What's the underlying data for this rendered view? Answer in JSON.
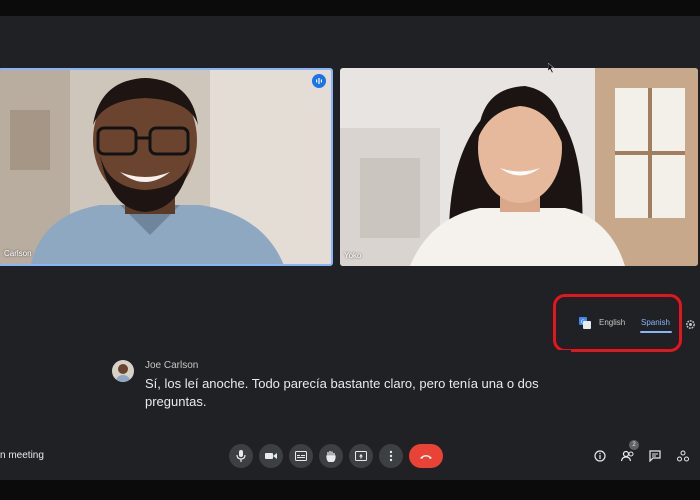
{
  "participants": [
    {
      "name": "Joe Carlson",
      "name_tag": "Carlson"
    },
    {
      "name": "Yoko",
      "name_tag": "Yoko"
    }
  ],
  "captions": {
    "languages": [
      "English",
      "Spanish"
    ],
    "selected_language": "Spanish",
    "speaker": "Joe Carlson",
    "text": "Sí, los leí anoche. Todo parecía bastante claro, pero tenía una o dos preguntas."
  },
  "bottom_bar": {
    "meeting_label": "n meeting",
    "people_count": "2"
  },
  "colors": {
    "background": "#202124",
    "accent": "#8ab4f8",
    "end_call": "#ea4335",
    "highlight": "#e8141b"
  },
  "icons": {
    "speaking": "speaking-icon",
    "translate": "translate-icon",
    "settings": "gear-icon",
    "mic": "mic-icon",
    "camera": "camera-icon",
    "captions": "captions-icon",
    "hand": "raise-hand-icon",
    "present": "present-icon",
    "more": "more-vert-icon",
    "end_call": "end-call-icon",
    "info": "info-icon",
    "people": "people-icon",
    "chat": "chat-icon",
    "activities": "activities-icon"
  }
}
